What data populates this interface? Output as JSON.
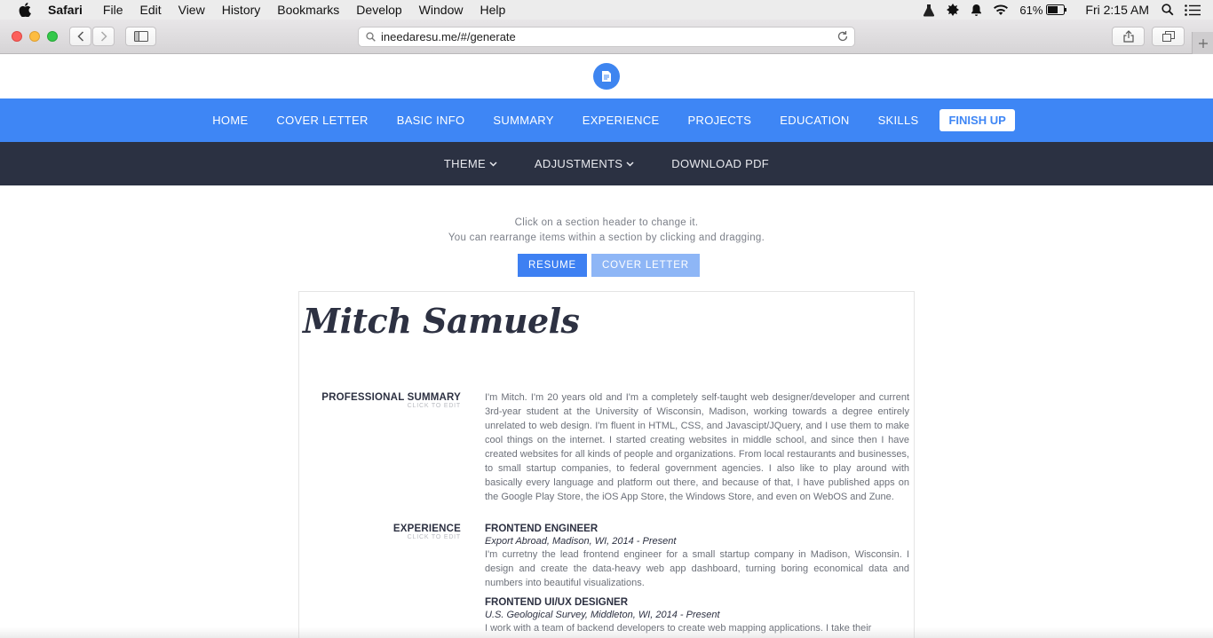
{
  "menubar": {
    "app": "Safari",
    "items": [
      "File",
      "Edit",
      "View",
      "History",
      "Bookmarks",
      "Develop",
      "Window",
      "Help"
    ],
    "battery": "61%",
    "clock": "Fri 2:15 AM"
  },
  "browser": {
    "url": "ineedaresu.me/#/generate"
  },
  "nav": {
    "items": [
      "HOME",
      "COVER LETTER",
      "BASIC INFO",
      "SUMMARY",
      "EXPERIENCE",
      "PROJECTS",
      "EDUCATION",
      "SKILLS"
    ],
    "finish": "FINISH UP"
  },
  "subnav": {
    "theme": "THEME",
    "adjustments": "ADJUSTMENTS",
    "download": "DOWNLOAD PDF"
  },
  "hint": {
    "line1": "Click on a section header to change it.",
    "line2": "You can rearrange items within a section by clicking and dragging."
  },
  "tabs": {
    "resume": "RESUME",
    "cover_letter": "COVER LETTER"
  },
  "resume": {
    "name": "Mitch Samuels",
    "summary": {
      "title": "PROFESSIONAL SUMMARY",
      "edit": "CLICK TO EDIT",
      "text": "I'm Mitch. I'm 20 years old and I'm a completely self-taught web designer/developer and current 3rd-year student at the University of Wisconsin, Madison, working towards a degree entirely unrelated to web design. I'm fluent in HTML, CSS, and Javascipt/JQuery, and I use them to make cool things on the internet. I started creating websites in middle school, and since then I have created websites for all kinds of people and organizations. From local restaurants and businesses, to small startup companies, to federal government agencies. I also like to play around with basically every language and platform out there, and because of that, I have published apps on the Google Play Store, the iOS App Store, the Windows Store, and even on WebOS and Zune."
    },
    "experience": {
      "title": "EXPERIENCE",
      "edit": "CLICK TO EDIT",
      "jobs": [
        {
          "title": "FRONTEND ENGINEER",
          "meta": "Export Abroad, Madison, WI, 2014 - Present",
          "desc": "I'm curretny the lead frontend engineer for a small startup company in Madison, Wisconsin. I design and create the data-heavy web app dashboard, turning boring economical data and numbers into beautiful visualizations."
        },
        {
          "title": "FRONTEND UI/UX DESIGNER",
          "meta": "U.S. Geological Survey, Middleton, WI, 2014 - Present",
          "desc": "I work with a team of backend developers to create web mapping applications. I take their"
        }
      ]
    }
  }
}
